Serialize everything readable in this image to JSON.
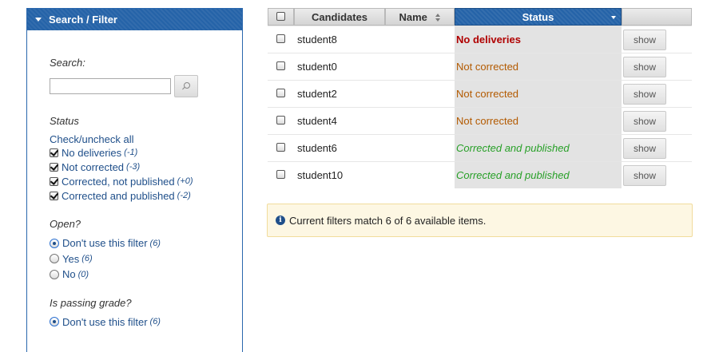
{
  "sidebar": {
    "title": "Search / Filter",
    "search_label": "Search:",
    "search_value": "",
    "status_label": "Status",
    "check_all": "Check/uncheck all",
    "status_options": [
      {
        "label": "No deliveries",
        "count": "(-1)",
        "checked": true
      },
      {
        "label": "Not corrected",
        "count": "(-3)",
        "checked": true
      },
      {
        "label": "Corrected, not published",
        "count": "(+0)",
        "checked": true
      },
      {
        "label": "Corrected and published",
        "count": "(-2)",
        "checked": true
      }
    ],
    "open_label": "Open?",
    "open_options": [
      {
        "label": "Don't use this filter",
        "count": "(6)",
        "selected": true
      },
      {
        "label": "Yes",
        "count": "(6)",
        "selected": false
      },
      {
        "label": "No",
        "count": "(0)",
        "selected": false
      }
    ],
    "passing_label": "Is passing grade?",
    "passing_options": [
      {
        "label": "Don't use this filter",
        "count": "(6)",
        "selected": true
      }
    ]
  },
  "table": {
    "headers": {
      "candidates": "Candidates",
      "name": "Name",
      "status": "Status"
    },
    "rows": [
      {
        "candidate": "student8",
        "name": "",
        "status": "No deliveries",
        "status_kind": "no-deliv",
        "action": "show"
      },
      {
        "candidate": "student0",
        "name": "",
        "status": "Not corrected",
        "status_kind": "not-corr",
        "action": "show"
      },
      {
        "candidate": "student2",
        "name": "",
        "status": "Not corrected",
        "status_kind": "not-corr",
        "action": "show"
      },
      {
        "candidate": "student4",
        "name": "",
        "status": "Not corrected",
        "status_kind": "not-corr",
        "action": "show"
      },
      {
        "candidate": "student6",
        "name": "",
        "status": "Corrected and published",
        "status_kind": "corr-pub",
        "action": "show"
      },
      {
        "candidate": "student10",
        "name": "",
        "status": "Corrected and published",
        "status_kind": "corr-pub",
        "action": "show"
      }
    ]
  },
  "info": {
    "icon": "info-icon",
    "text": "Current filters match 6 of 6 available items."
  },
  "colors": {
    "header_blue": "#2563a8",
    "no_deliveries": "#b00000",
    "not_corrected": "#b35a00",
    "corrected_published": "#28a028",
    "info_bg": "#fdf7e3"
  }
}
